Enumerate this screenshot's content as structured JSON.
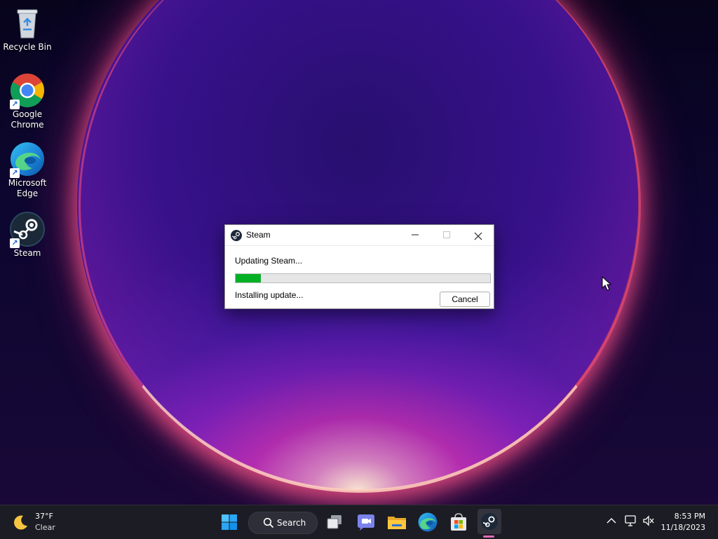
{
  "desktop": {
    "icons": [
      {
        "label": "Recycle Bin"
      },
      {
        "label": "Google\nChrome"
      },
      {
        "label": "Microsoft\nEdge"
      },
      {
        "label": "Steam"
      }
    ]
  },
  "dialog": {
    "title": "Steam",
    "status": "Updating Steam...",
    "progress_fraction": 0.1,
    "substatus": "Installing update...",
    "cancel_label": "Cancel",
    "progress_color": "#06b025"
  },
  "taskbar": {
    "weather": {
      "temp": "37°F",
      "condition": "Clear",
      "icon": "moon-icon"
    },
    "search_label": "Search",
    "apps": [
      "start-icon",
      "task-view-icon",
      "teams-chat-icon",
      "file-explorer-icon",
      "edge-icon",
      "store-icon",
      "steam-icon"
    ],
    "clock": {
      "time": "8:53 PM",
      "date": "11/18/2023"
    },
    "tray_icons": [
      "chevron-up-icon",
      "network-icon",
      "volume-muted-icon"
    ]
  }
}
